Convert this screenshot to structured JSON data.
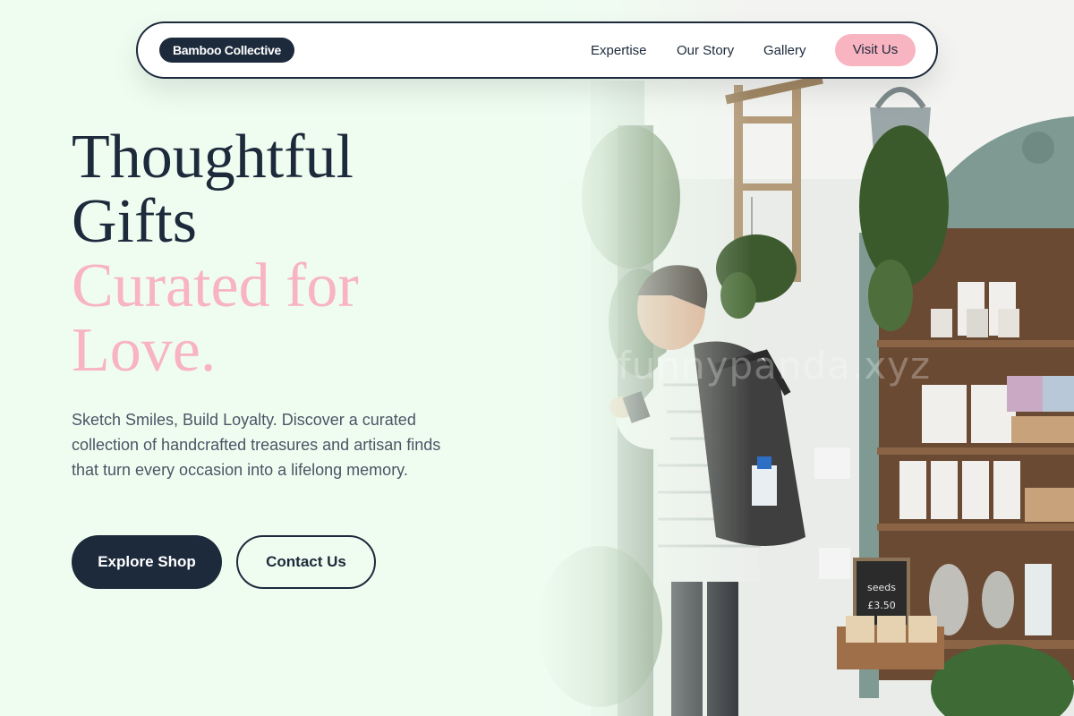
{
  "nav": {
    "brand": "Bamboo Collective",
    "links": [
      "Expertise",
      "Our Story",
      "Gallery"
    ],
    "cta": "Visit Us"
  },
  "hero": {
    "headline_line1": "Thoughtful",
    "headline_line2": "Gifts",
    "headline_line3": "Curated for",
    "headline_line4": "Love.",
    "description": "Sketch Smiles, Build Loyalty. Discover a curated collection of handcrafted treasures and artisan finds that turn every occasion into a lifelong memory.",
    "primary_button": "Explore Shop",
    "secondary_button": "Contact Us"
  },
  "image": {
    "watermark": "funnypanda.xyz",
    "chalkboard_text": "seeds £3.50"
  },
  "colors": {
    "background": "#effdf1",
    "dark": "#1d2a3c",
    "accent_pink": "#f8b4c0",
    "body_text": "#4a5565"
  }
}
